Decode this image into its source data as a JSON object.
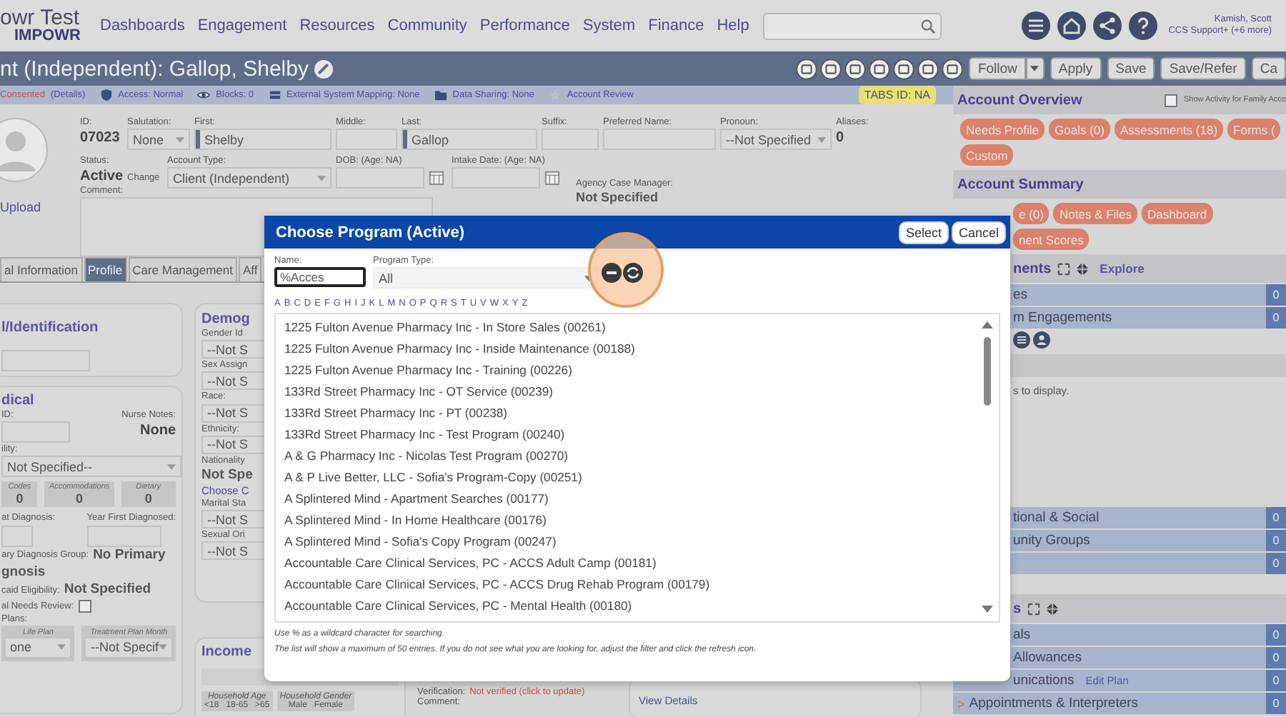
{
  "header": {
    "logo_line1": "owr Test",
    "logo_line2": "IMPOWR",
    "nav": [
      "Dashboards",
      "Engagement",
      "Resources",
      "Community",
      "Performance",
      "System",
      "Finance",
      "Help"
    ],
    "user_name": "Kamish, Scott",
    "user_role": "CCS Support+ (+6 more)"
  },
  "title_bar": {
    "title": "nt (Independent): Gallop, Shelby",
    "buttons": [
      {
        "label": "Follow",
        "kind": "dropdown"
      },
      {
        "label": "Apply",
        "kind": "plain"
      },
      {
        "label": "Save",
        "kind": "plain"
      },
      {
        "label": "Save/Refer",
        "kind": "plain"
      },
      {
        "label": "Ca",
        "kind": "plain"
      }
    ]
  },
  "info_bar": {
    "consent": "Consented",
    "consent_link": "(Details)",
    "items": [
      "Access: Normal",
      "Blocks: 0",
      "External System Mapping: None",
      "Data Sharing: None",
      "Account Review"
    ],
    "tabs_id": "TABS ID: NA"
  },
  "profile": {
    "upload": "Upload",
    "id_label": "ID:",
    "id": "07023",
    "status_label": "Status:",
    "status": "Active",
    "status_link": "Change",
    "fields": [
      {
        "label": "Salutation:",
        "kind": "select",
        "value": "None"
      },
      {
        "label": "First:",
        "kind": "text",
        "value": "Shelby",
        "required": true
      },
      {
        "label": "Middle:",
        "kind": "text",
        "required": false
      },
      {
        "label": "Last:",
        "kind": "text",
        "value": "Gallop",
        "required": true
      },
      {
        "label": "Suffix:",
        "kind": "text",
        "required": false
      },
      {
        "label": "Preferred Name:",
        "kind": "text",
        "required": false
      },
      {
        "label": "Pronoun:",
        "kind": "select",
        "value": "--Not Specified"
      },
      {
        "label": "Aliases:",
        "kind": "static",
        "value": "0"
      }
    ],
    "fields2": [
      {
        "label": "Account Type:",
        "kind": "select",
        "value": "Client (Independent)"
      },
      {
        "label": "DOB: (Age: NA)",
        "kind": "date"
      },
      {
        "label": "Intake Date: (Age: NA)",
        "kind": "date"
      }
    ],
    "comment_label": "Comment:",
    "case_manager_label": "Agency Case Manager:",
    "case_manager": "Not Specified"
  },
  "tabs": [
    {
      "label": "al Information",
      "selected": false
    },
    {
      "label": "Profile",
      "selected": true
    },
    {
      "label": "Care Management",
      "selected": false
    },
    {
      "label": "Aff",
      "selected": false
    }
  ],
  "identification": {
    "title": "l/Identification"
  },
  "medical": {
    "title": "dical",
    "id_label": "ID:",
    "nurse_label": "Nurse Notes:",
    "nurse_value": "None",
    "eligibility_label": "ility:",
    "eligibility_value": "Not Specified--",
    "counters": [
      {
        "label": "Codes",
        "value": "0"
      },
      {
        "label": "Accommodations",
        "value": "0"
      },
      {
        "label": "Dietary",
        "value": "0"
      }
    ],
    "diagnosis_label": "at Diagnosis:",
    "year_label": "Year First Diagnosed:",
    "group_label": "ary Diagnosis Group:",
    "group_value": "No Primary",
    "group_value_cont": "gnosis",
    "medicaid_label": "caid Eligibility:",
    "medicaid_value": "Not Specified",
    "review_label": "al Needs Review:",
    "review_checked": false,
    "plans_label": "Plans:",
    "plans": [
      {
        "title": "Life Plan",
        "value": "one"
      },
      {
        "title": "Treatment Plan Month",
        "value": "--Not Specif"
      }
    ]
  },
  "demographics": {
    "title": "Demog",
    "fields": [
      {
        "label": "Gender Id",
        "kind": "select",
        "value": "--Not S"
      },
      {
        "label": "Sex Assign",
        "kind": "select",
        "value": "--Not S"
      },
      {
        "label": "Race:",
        "kind": "select",
        "value": "--Not S"
      },
      {
        "label": "Ethnicity:",
        "kind": "select",
        "value": "--Not S"
      },
      {
        "label": "Nationality",
        "kind": "static",
        "value": "Not Spe",
        "link": "Choose C"
      },
      {
        "label": "Marital Sta",
        "kind": "select",
        "value": "--Not S"
      },
      {
        "label": "Sexual Ori",
        "kind": "select",
        "value": "--Not S"
      }
    ]
  },
  "income": {
    "title": "Income",
    "household": [
      {
        "title": "Household Age",
        "options": [
          "<18",
          "18-65",
          ">65"
        ]
      },
      {
        "title": "Household Gender",
        "options": [
          "Male",
          "Female"
        ]
      }
    ]
  },
  "verification": {
    "label": "Verification:",
    "status": "Not verified (click to update)",
    "comment_label": "Comment:"
  },
  "view_details": "View Details",
  "right_panel": {
    "overview_title": "Account Overview",
    "family_toggle": {
      "label": "Show Activity for Family Acco",
      "checked": false
    },
    "overview_pills": [
      "Needs Profile",
      "Goals (0)",
      "Assessments (18)",
      "Forms (",
      "Custom"
    ],
    "summary_title": "Account Summary",
    "summary_pills": [
      "e (0)",
      "Notes & Files",
      "Dashboard",
      "nent Scores"
    ],
    "engagements_title": "nents",
    "explore": "Explore",
    "engagement_rows": [
      {
        "label": "es",
        "count": "0"
      },
      {
        "label": "m Engagements",
        "count": "0"
      }
    ],
    "empty_message": "s to display.",
    "social_rows": [
      {
        "label": "tional & Social",
        "count": "0"
      },
      {
        "label": "unity Groups",
        "count": "0"
      },
      {
        "count": "0"
      }
    ],
    "services_title": "s",
    "service_rows": [
      {
        "label": "als",
        "count": "0"
      },
      {
        "label": "Allowances",
        "count": "0"
      },
      {
        "label": "unications",
        "link": "Edit Plan",
        "count": "0"
      },
      {
        "label": "Appointments & Interpreters",
        "count": "0",
        "marker": ">"
      }
    ]
  },
  "dialog": {
    "title": "Choose Program (Active)",
    "buttons": [
      "Select",
      "Cancel"
    ],
    "name_label": "Name:",
    "name_value": "%Acces",
    "type_label": "Program Type:",
    "type_value": "All",
    "letters": [
      "A",
      "B",
      "C",
      "D",
      "E",
      "F",
      "G",
      "H",
      "I",
      "J",
      "K",
      "L",
      "M",
      "N",
      "O",
      "P",
      "Q",
      "R",
      "S",
      "T",
      "U",
      "V",
      "W",
      "X",
      "Y",
      "Z"
    ],
    "programs": [
      {
        "name": "1225 Fulton Avenue Pharmacy Inc - In Store Sales (00261)",
        "selected": false
      },
      {
        "name": "1225 Fulton Avenue Pharmacy Inc - Inside Maintenance (00188)",
        "selected": false
      },
      {
        "name": "1225 Fulton Avenue Pharmacy Inc - Training (00226)",
        "selected": false
      },
      {
        "name": "133Rd Street Pharmacy Inc - OT Service (00239)",
        "selected": false
      },
      {
        "name": "133Rd Street Pharmacy Inc - PT (00238)",
        "selected": false
      },
      {
        "name": "133Rd Street Pharmacy Inc - Test Program (00240)",
        "selected": false
      },
      {
        "name": "A & G Pharmacy Inc - Nicolas Test Program (00270)",
        "selected": false
      },
      {
        "name": "A & P Live Better, LLC - Sofia's Program-Copy (00251)",
        "selected": false
      },
      {
        "name": "A Splintered Mind - Apartment Searches (00177)",
        "selected": false
      },
      {
        "name": "A Splintered Mind - In Home Healthcare (00176)",
        "selected": false
      },
      {
        "name": "A Splintered Mind - Sofia's Copy Program (00247)",
        "selected": false
      },
      {
        "name": "Accountable Care Clinical Services, PC - ACCS Adult Camp (00181)",
        "selected": false
      },
      {
        "name": "Accountable Care Clinical Services, PC - ACCS Drug Rehab Program (00179)",
        "selected": false
      },
      {
        "name": "Accountable Care Clinical Services, PC - Mental Health (00180)",
        "selected": false
      }
    ],
    "notes": [
      "Use % as a wildcard character for searching.",
      "The list will show a maximum of 50 entries. If you do not see what you are looking for, adjust the filter and click the refresh icon."
    ]
  }
}
